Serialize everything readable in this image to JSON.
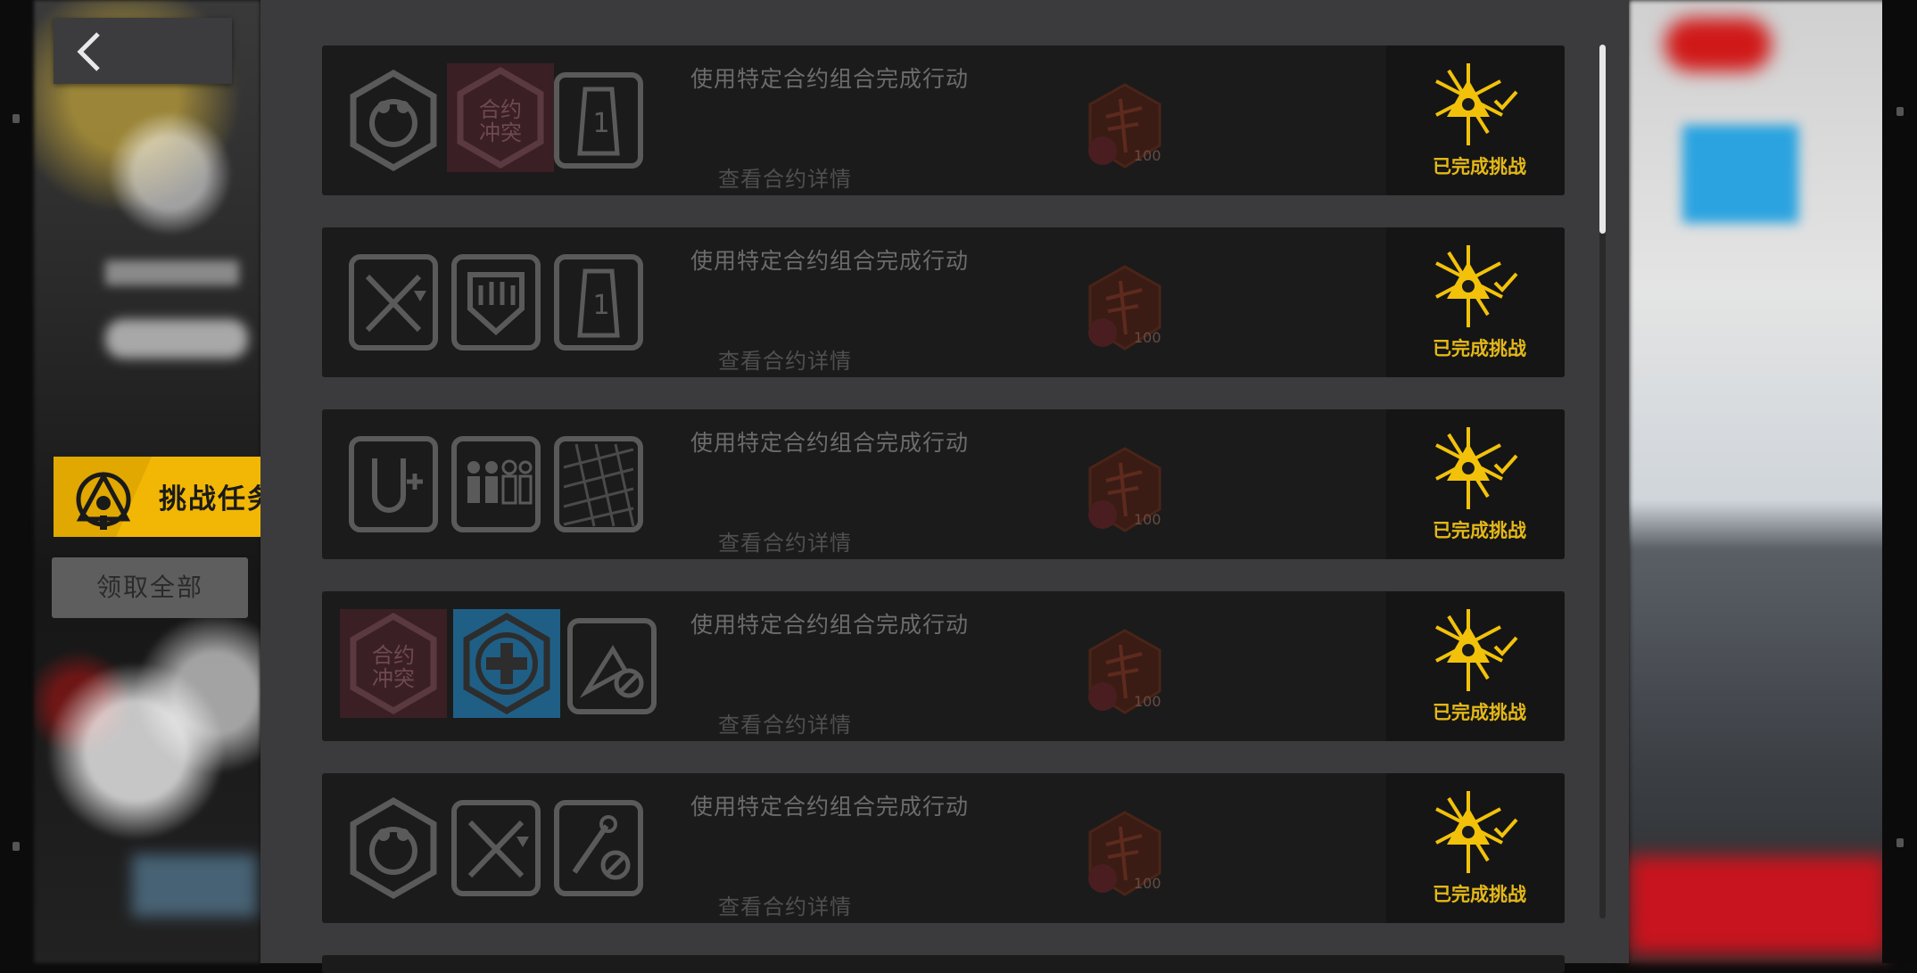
{
  "sidebar": {
    "challenge_tab_label": "挑战任务",
    "claim_all_label": "领取全部"
  },
  "tasks": [
    {
      "title": "使用特定合约组合完成行动",
      "link": "查看合约详情",
      "contracts": [
        "frog-mask-icon",
        "contract-conflict-icon",
        "tower-1-icon"
      ],
      "reward_count": "100",
      "status": "已完成挑战"
    },
    {
      "title": "使用特定合约组合完成行动",
      "link": "查看合约详情",
      "contracts": [
        "crossed-swords-icon",
        "shield-fist-icon",
        "tower-1-icon"
      ],
      "reward_count": "100",
      "status": "已完成挑战"
    },
    {
      "title": "使用特定合约组合完成行动",
      "link": "查看合约详情",
      "contracts": [
        "horseshoe-plus-icon",
        "squad-icon",
        "grid-icon"
      ],
      "reward_count": "100",
      "status": "已完成挑战"
    },
    {
      "title": "使用特定合约组合完成行动",
      "link": "查看合约详情",
      "contracts": [
        "contract-conflict-icon",
        "medical-cross-icon",
        "no-heal-triangle-icon"
      ],
      "reward_count": "100",
      "status": "已完成挑战"
    },
    {
      "title": "使用特定合约组合完成行动",
      "link": "查看合约详情",
      "contracts": [
        "frog-mask-icon",
        "crossed-swords-icon",
        "no-skill-icon"
      ],
      "reward_count": "100",
      "status": "已完成挑战"
    }
  ],
  "colors": {
    "accent": "#f2b705",
    "panel": "#3b3b3d",
    "row": "#1b1b1c",
    "done_text": "#e4b818"
  }
}
